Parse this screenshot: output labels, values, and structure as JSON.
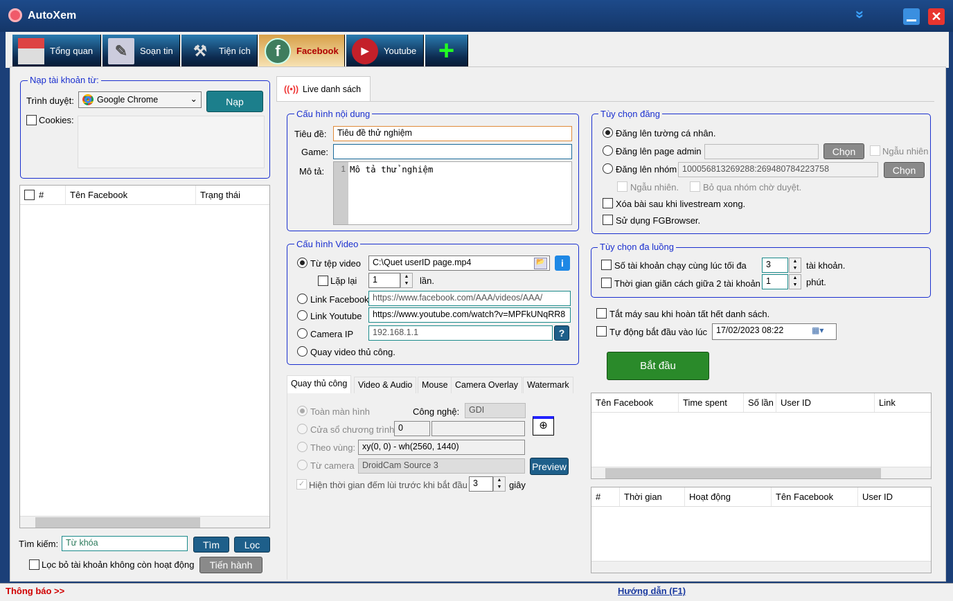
{
  "app": {
    "title": "AutoXem",
    "accent": "#1a2fcf"
  },
  "tabs": [
    {
      "label": "Tổng quan",
      "icon": "home-icon"
    },
    {
      "label": "Soạn tin",
      "icon": "pen-icon"
    },
    {
      "label": "Tiện ích",
      "icon": "hammer-icon"
    },
    {
      "label": "Facebook",
      "icon": "facebook-icon",
      "active": true
    },
    {
      "label": "Youtube",
      "icon": "youtube-icon"
    },
    {
      "label": "",
      "icon": "plus-icon"
    }
  ],
  "left": {
    "load_group": "Nạp tài khoản từ:",
    "browser_label": "Trình duyệt:",
    "browser_value": "Google Chrome",
    "load_btn": "Nạp",
    "cookies_label": "Cookies:",
    "table_headers": [
      "#",
      "Tên Facebook",
      "Trạng thái"
    ],
    "search_label": "Tìm kiếm:",
    "search_placeholder": "Từ khóa",
    "find_btn": "Tìm",
    "filter_btn": "Lọc",
    "filter_inactive": "Lọc bỏ tài khoản không còn hoạt động",
    "proceed_btn": "Tiến hành"
  },
  "center": {
    "tab": "Live danh sách",
    "content_group": "Cấu hình nội dung",
    "title_label": "Tiêu đề:",
    "title_value": "Tiêu đề thử nghiệm",
    "game_label": "Game:",
    "game_value": "",
    "desc_label": "Mô tả:",
    "desc_line": "1",
    "desc_value": "Mô tả thử nghiệm",
    "video_group": "Cấu hình Video",
    "from_file": "Từ tệp video",
    "file_value": "C:\\Quet userID page.mp4",
    "repeat": "Lặp lại",
    "repeat_value": "1",
    "times": "lần.",
    "link_fb": "Link Facebook",
    "link_fb_value": "https://www.facebook.com/AAA/videos/AAA/",
    "link_yt": "Link Youtube",
    "link_yt_value": "https://www.youtube.com/watch?v=MPFkUNqRR8",
    "camera_ip": "Camera IP",
    "camera_ip_value": "192.168.1.1",
    "help": "?",
    "manual": "Quay video thủ công.",
    "subtabs": [
      "Quay thủ công",
      "Video & Audio",
      "Mouse",
      "Camera Overlay",
      "Watermark"
    ],
    "fullscreen": "Toàn màn hình",
    "tech_label": "Công nghệ:",
    "tech_value": "GDI",
    "window": "Cửa sổ chương trình",
    "window_value": "0",
    "region": "Theo vùng:",
    "region_value": "xy(0, 0) - wh(2560, 1440)",
    "camera": "Từ camera",
    "camera_value": "DroidCam Source 3",
    "preview_btn": "Preview",
    "countdown": "Hiện thời gian đếm lùi trước khi bắt đầu",
    "countdown_value": "3",
    "seconds": "giây"
  },
  "right": {
    "post_group": "Tùy chọn đăng",
    "post_wall": "Đăng lên tường cá nhân.",
    "post_page": "Đăng lên page admin",
    "choose_btn": "Chọn",
    "random": "Ngẫu nhiên",
    "post_group_opt": "Đăng lên nhóm",
    "group_value": "100056813269288:269480784223758",
    "random2": "Ngẫu nhiên.",
    "skip_pending": "Bỏ qua nhóm chờ duyệt.",
    "delete_after": "Xóa bài sau khi livestream xong.",
    "use_fg": "Sử dụng FGBrowser.",
    "thread_group": "Tùy chọn đa luồng",
    "max_accounts": "Số tài khoản chạy cùng lúc tối đa",
    "max_value": "3",
    "accounts_unit": "tài khoản.",
    "interval": "Thời gian giãn cách giữa 2 tài khoản",
    "interval_value": "1",
    "minutes": "phút.",
    "shutdown": "Tắt máy sau khi hoàn tất hết danh sách.",
    "auto_start": "Tự động bắt đầu vào lúc",
    "auto_start_value": "17/02/2023 08:22",
    "start_btn": "Bắt đầu",
    "table1_headers": [
      "Tên Facebook",
      "Time spent",
      "Số lần",
      "User ID",
      "Link"
    ],
    "table2_headers": [
      "#",
      "Thời gian",
      "Hoạt động",
      "Tên Facebook",
      "User ID"
    ]
  },
  "status": {
    "notice": "Thông báo >>",
    "help": "Hướng dẫn (F1)"
  }
}
